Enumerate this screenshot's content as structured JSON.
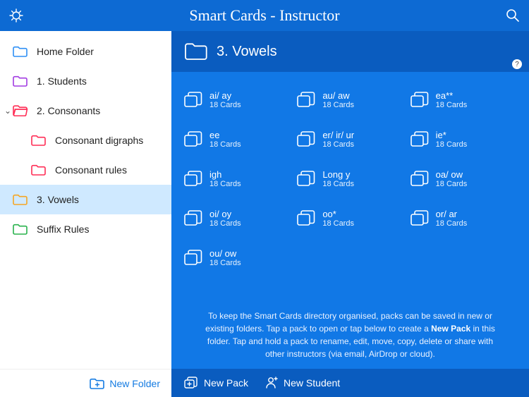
{
  "app_title": "Smart Cards - Instructor",
  "sidebar": {
    "items": [
      {
        "label": "Home Folder",
        "color": "#2e8ff5"
      },
      {
        "label": "1. Students",
        "color": "#a23be2"
      },
      {
        "label": "2. Consonants",
        "color": "#ff2d55"
      },
      {
        "label": "Consonant digraphs",
        "color": "#ff2d55"
      },
      {
        "label": "Consonant rules",
        "color": "#ff2d55"
      },
      {
        "label": "3. Vowels",
        "color": "#f5a623"
      },
      {
        "label": "Suffix Rules",
        "color": "#28b24c"
      }
    ],
    "new_folder": "New Folder"
  },
  "main": {
    "title": "3. Vowels",
    "packs": [
      {
        "name": "ai/ ay",
        "sub": "18 Cards"
      },
      {
        "name": "au/ aw",
        "sub": "18 Cards"
      },
      {
        "name": "ea**",
        "sub": "18 Cards"
      },
      {
        "name": "ee",
        "sub": "18 Cards"
      },
      {
        "name": "er/ ir/ ur",
        "sub": "18 Cards"
      },
      {
        "name": "ie*",
        "sub": "18 Cards"
      },
      {
        "name": "igh",
        "sub": "18 Cards"
      },
      {
        "name": "Long y",
        "sub": "18 Cards"
      },
      {
        "name": "oa/ ow",
        "sub": "18 Cards"
      },
      {
        "name": "oi/ oy",
        "sub": "18 Cards"
      },
      {
        "name": "oo*",
        "sub": "18 Cards"
      },
      {
        "name": "or/ ar",
        "sub": "18 Cards"
      },
      {
        "name": "ou/ ow",
        "sub": "18 Cards"
      }
    ],
    "hint_pre": "To keep the Smart Cards directory organised, packs can be saved in new or existing folders. Tap a pack to open or tap below to create a ",
    "hint_bold": "New Pack",
    "hint_post": " in this folder. Tap and hold a pack to rename, edit, move, copy, delete or share with other instructors (via email, AirDrop or cloud).",
    "footer": {
      "new_pack": "New Pack",
      "new_student": "New Student"
    }
  }
}
